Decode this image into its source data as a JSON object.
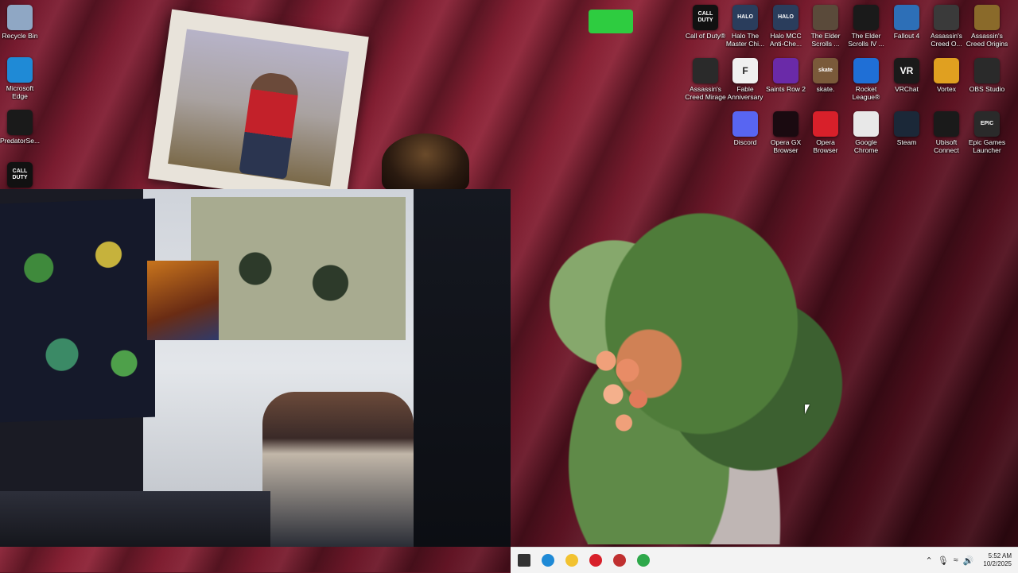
{
  "desktop": {
    "left_icons": [
      {
        "label": "Recycle Bin",
        "icon": "recycle-bin-icon",
        "color": "#8fa7c4"
      },
      {
        "label": "Microsoft Edge",
        "icon": "edge-icon",
        "color": "#1f8ad6"
      },
      {
        "label": "PredatorSe...",
        "icon": "predator-sense-icon",
        "color": "#1a1a1a"
      },
      {
        "label": "",
        "icon": "call-of-duty-icon",
        "color": "#111111",
        "glyph": "CALL\nDUTY"
      }
    ],
    "right_icons": [
      {
        "label": "Call of Duty®",
        "icon": "call-of-duty-icon",
        "color": "#111111",
        "glyph": "CALL DUTY"
      },
      {
        "label": "Halo The Master Chi...",
        "icon": "halo-icon",
        "color": "#2a3d5c",
        "glyph": "HALO"
      },
      {
        "label": "Halo MCC Anti-Che...",
        "icon": "halo-mcc-icon",
        "color": "#2a3d5c",
        "glyph": "HALO"
      },
      {
        "label": "The Elder Scrolls ...",
        "icon": "elder-scrolls-icon",
        "color": "#5a4a3a"
      },
      {
        "label": "The Elder Scrolls IV ...",
        "icon": "oblivion-icon",
        "color": "#1a1a1a"
      },
      {
        "label": "Fallout 4",
        "icon": "fallout-icon",
        "color": "#2d6fb7"
      },
      {
        "label": "Assassin's Creed O...",
        "icon": "assassins-creed-icon",
        "color": "#3a3a3a"
      },
      {
        "label": "Assassin's Creed Origins",
        "icon": "assassins-creed-origins-icon",
        "color": "#8a6a2a"
      },
      {
        "label": "Assassin's Creed Mirage",
        "icon": "assassins-creed-mirage-icon",
        "color": "#2a2a2a"
      },
      {
        "label": "Fable Anniversary",
        "icon": "fable-icon",
        "color": "#f0f0f0",
        "glyph": "F"
      },
      {
        "label": "Saints Row 2",
        "icon": "saints-row-icon",
        "color": "#6a2aa8"
      },
      {
        "label": "skate.",
        "icon": "skate-icon",
        "color": "#7a5a3a",
        "glyph": "skate"
      },
      {
        "label": "Rocket League®",
        "icon": "rocket-league-icon",
        "color": "#1f6fd6"
      },
      {
        "label": "VRChat",
        "icon": "vrchat-icon",
        "color": "#1a1a1a",
        "glyph": "VR"
      },
      {
        "label": "Vortex",
        "icon": "vortex-icon",
        "color": "#e0a020"
      },
      {
        "label": "OBS Studio",
        "icon": "obs-icon",
        "color": "#2a2a2a"
      },
      {
        "label": "Discord",
        "icon": "discord-icon",
        "color": "#5865f2"
      },
      {
        "label": "Opera GX Browser",
        "icon": "opera-gx-icon",
        "color": "#1a0a10"
      },
      {
        "label": "Opera Browser",
        "icon": "opera-icon",
        "color": "#d8202a"
      },
      {
        "label": "Google Chrome",
        "icon": "chrome-icon",
        "color": "#e8e8e8"
      },
      {
        "label": "Steam",
        "icon": "steam-icon",
        "color": "#1b2838"
      },
      {
        "label": "Ubisoft Connect",
        "icon": "ubisoft-icon",
        "color": "#1a1a1a"
      },
      {
        "label": "Epic Games Launcher",
        "icon": "epic-games-icon",
        "color": "#2a2a2a",
        "glyph": "EPIC"
      }
    ]
  },
  "taskbar": {
    "apps": [
      {
        "icon": "start-icon",
        "name": "Start"
      },
      {
        "icon": "edge-icon",
        "name": "Microsoft Edge"
      },
      {
        "icon": "file-explorer-icon",
        "name": "File Explorer"
      },
      {
        "icon": "opera-icon",
        "name": "Opera"
      },
      {
        "icon": "app-icon",
        "name": "App"
      },
      {
        "icon": "nvidia-icon",
        "name": "App"
      }
    ],
    "clock_time": "5:52 AM",
    "clock_date": "10/2/2025"
  }
}
